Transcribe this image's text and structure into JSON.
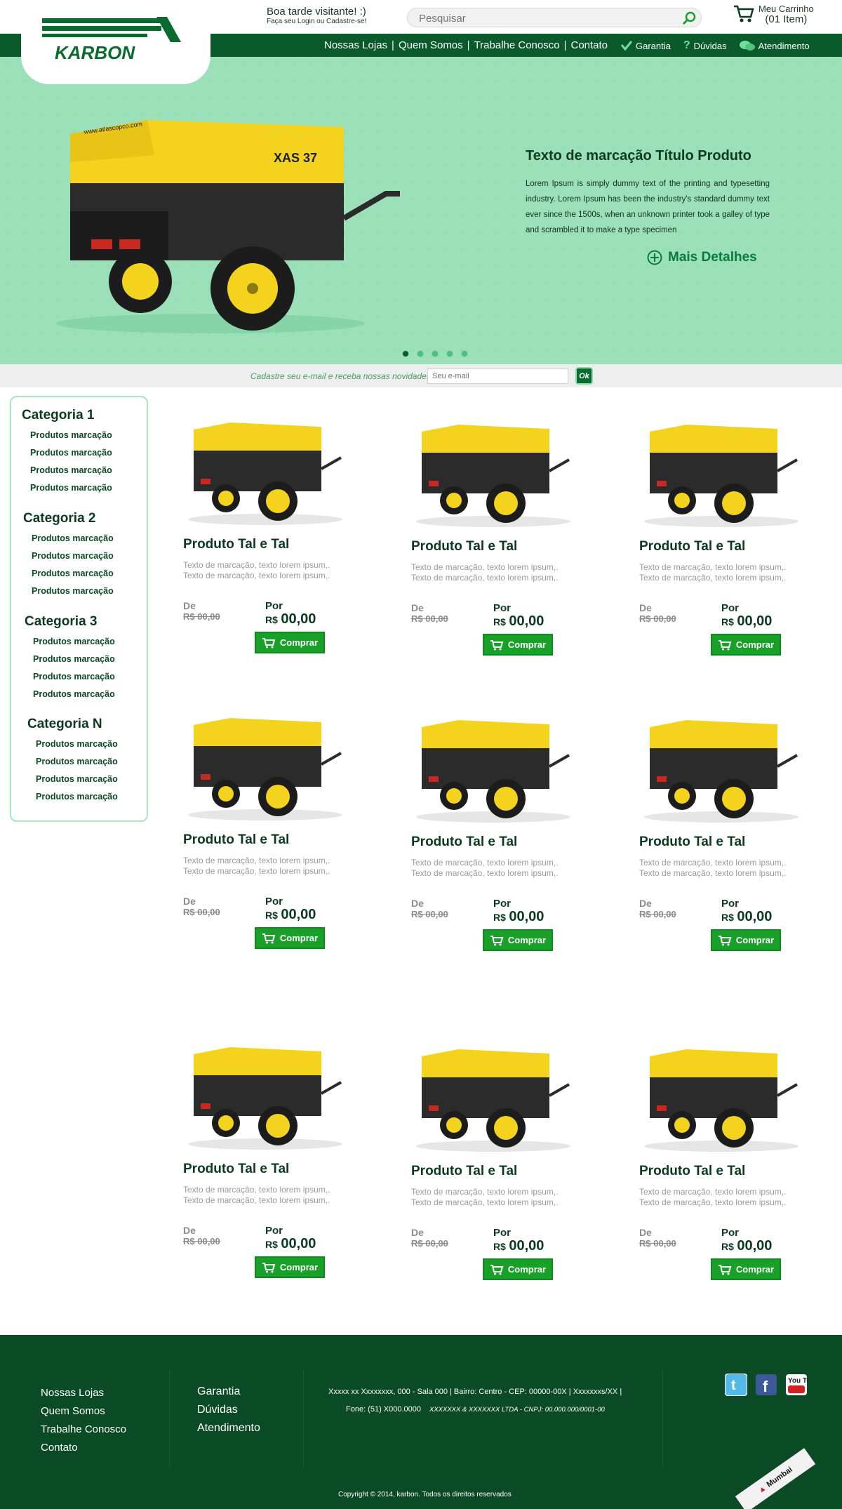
{
  "colors": {
    "brand_green": "#0a5a2c",
    "hero_bg": "#9be0b8",
    "accent_green": "#19a028",
    "footer_bg": "#0a4a25"
  },
  "header": {
    "logo_text": "KARBON",
    "greeting": "Boa tarde visitante! :)",
    "login_text": "Faça seu Login ou Cadastre-se!",
    "search_placeholder": "Pesquisar",
    "cart_title": "Meu Carrinho",
    "cart_count": "(01 Item)",
    "nav": [
      "Nossas Lojas",
      "|",
      "Quem Somos",
      "|",
      "Trabalhe Conosco",
      "|",
      "Contato"
    ],
    "side_nav": [
      "Garantia",
      "Dúvidas",
      "Atendimento"
    ]
  },
  "hero": {
    "title": "Texto de marcação Título Produto",
    "description": "Lorem Ipsum is simply dummy text of the printing and typesetting industry. Lorem Ipsum has been the industry's standard dummy text ever since the 1500s, when an unknown printer took a galley of type and scrambled it to make a type specimen",
    "more_label": "Mais Detalhes",
    "product_label": "XAS 37",
    "brand_label": "www.atlascopco.com",
    "slides": 5,
    "active_slide": 1
  },
  "newsletter": {
    "label": "Cadastre seu e-mail e receba nossas novidades",
    "placeholder": "Seu e-mail",
    "button": "Ok"
  },
  "sidebar": {
    "categories": [
      {
        "name": "Categoria 1",
        "items": [
          "Produtos marcação",
          "Produtos marcação",
          "Produtos marcação",
          "Produtos marcação"
        ]
      },
      {
        "name": "Categoria 2",
        "items": [
          "Produtos marcação",
          "Produtos marcação",
          "Produtos marcação",
          "Produtos marcação"
        ]
      },
      {
        "name": "Categoria 3",
        "items": [
          "Produtos marcação",
          "Produtos marcação",
          "Produtos marcação",
          "Produtos marcação"
        ]
      },
      {
        "name": "Categoria N",
        "items": [
          "Produtos marcação",
          "Produtos marcação",
          "Produtos marcação",
          "Produtos marcação"
        ]
      }
    ]
  },
  "product": {
    "name": "Produto Tal e Tal",
    "description": "Texto de marcação, texto lorem ipsum,. Texto de marcação, texto lorem ipsum,.",
    "from_label": "De",
    "old_price": "R$ 00,00",
    "to_label": "Por",
    "currency": "R$",
    "price": "00,00",
    "buy_label": "Comprar",
    "count": 9
  },
  "footer": {
    "col1": [
      "Nossas Lojas",
      "Quem Somos",
      "Trabalhe Conosco",
      "Contato"
    ],
    "col2": [
      "Garantia",
      "Dúvidas",
      "Atendimento"
    ],
    "address": "Xxxxx xx Xxxxxxxx, 000 - Sala 000 | Bairro: Centro - CEP: 00000-00X | Xxxxxxxs/XX |",
    "phone": "Fone: (51) X000.0000",
    "company": "XXXXXXX & XXXXXXX LTDA - CNPJ: 00.000.000/0001-00",
    "copyright": "Copyright © 2014, karbon. Todos os direitos reservados",
    "social": [
      "twitter-icon",
      "facebook-icon",
      "youtube-icon"
    ],
    "youtube_label": "You Tube",
    "agency": "Mumbai"
  }
}
